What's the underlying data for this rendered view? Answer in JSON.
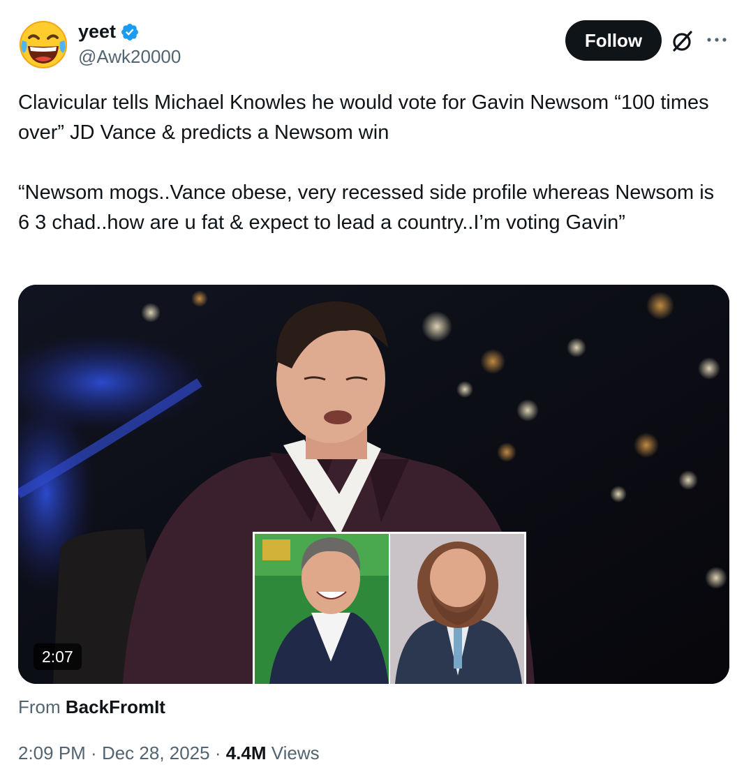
{
  "author": {
    "display_name": "yeet",
    "handle": "@Awk20000",
    "verified": true,
    "avatar_icon": "face-with-tears-of-joy-emoji"
  },
  "actions": {
    "follow_label": "Follow",
    "grok_icon": "grok-icon",
    "more_icon": "more-horizontal-icon"
  },
  "tweet": {
    "text": "Clavicular tells Michael Knowles he would vote for Gavin Newsom “100 times over” JD Vance & predicts a Newsom win\n\n“Newsom mogs..Vance obese, very recessed side profile whereas Newsom is 6 3 chad..how are u fat & expect to lead a country..I’m voting Gavin”"
  },
  "media": {
    "type": "video",
    "duration": "2:07"
  },
  "source": {
    "prefix": "From",
    "name": "BackFromIt"
  },
  "meta": {
    "time": "2:09 PM",
    "separator": " · ",
    "date": "Dec 28, 2025",
    "views_count": "4.4M",
    "views_label": "Views"
  },
  "colors": {
    "verified_badge": "#1d9bf0",
    "follow_bg": "#0f1419",
    "secondary_text": "#536471",
    "primary_text": "#0f1419"
  }
}
